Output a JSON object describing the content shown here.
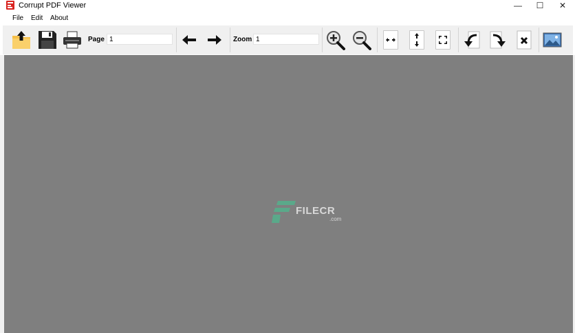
{
  "window": {
    "title": "Corrupt PDF Viewer",
    "minimize": "—",
    "maximize": "☐",
    "close": "✕"
  },
  "menu": [
    "File",
    "Edit",
    "About"
  ],
  "toolbar": {
    "page_label": "Page",
    "page_value": "1",
    "zoom_label": "Zoom",
    "zoom_value": "1",
    "buttons": [
      "open-icon",
      "save-icon",
      "print-icon",
      "previous-page-icon",
      "next-page-icon",
      "zoom-in-icon",
      "zoom-out-icon",
      "fit-width-icon",
      "fit-height-icon",
      "fit-page-icon",
      "rotate-left-icon",
      "rotate-right-icon",
      "close-document-icon",
      "image-icon"
    ]
  },
  "watermark": {
    "text": "FILECR",
    "sub": ".com"
  },
  "colors": {
    "viewer_bg": "#7f7f7f",
    "toolbar_bg": "#f0f0f0",
    "app_icon": "#d9231f"
  }
}
